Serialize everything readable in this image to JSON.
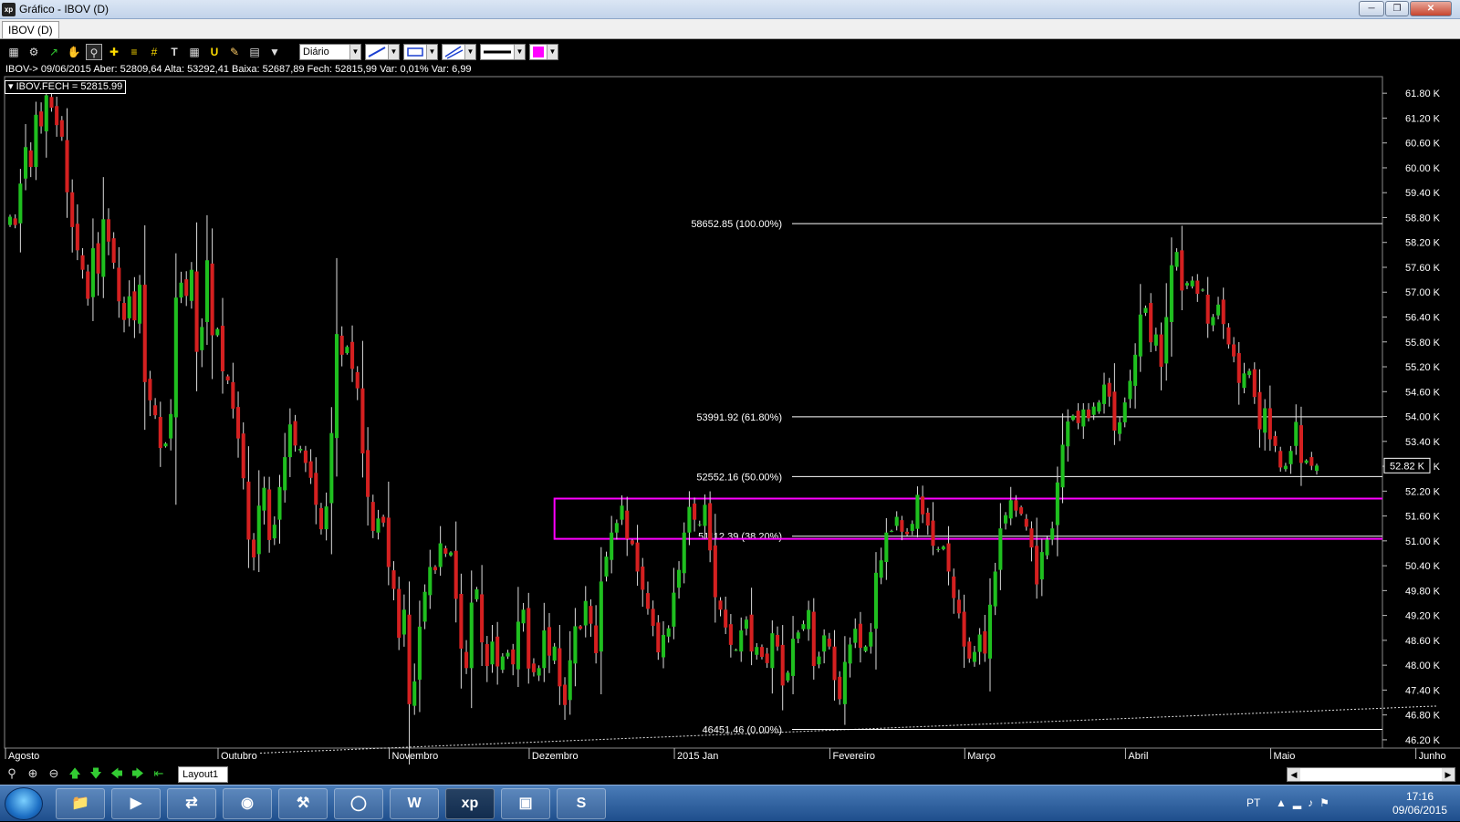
{
  "window": {
    "title": "Gráfico - IBOV (D)",
    "app_icon": "xp",
    "controls": [
      "minimize-icon",
      "restore-icon",
      "close-icon"
    ]
  },
  "tab": {
    "label": "IBOV (D)"
  },
  "toolbar": {
    "icons": [
      "chart-icon",
      "gear-icon",
      "trend-icon",
      "hand-icon",
      "zoom-select-icon",
      "crosshair-icon",
      "fibonacci-icon",
      "grid-icon",
      "text-icon",
      "calculator-icon",
      "magnet-icon",
      "brush-icon",
      "clipboard-icon",
      "filter-icon"
    ],
    "period": "Diário",
    "draw_color": "#ff00ff"
  },
  "info_line": "IBOV-> 09/06/2015 Aber: 52809,64 Alta: 53292,41 Baixa: 52687,89 Fech: 52815,99 Var: 0,01% Var: 6,99",
  "legend": "IBOV.FECH = 52815.99",
  "chart_data": {
    "type": "candlestick",
    "symbol": "IBOV",
    "ylim": [
      46000,
      62200
    ],
    "y_ticks": [
      "61.80 K",
      "61.20 K",
      "60.60 K",
      "60.00 K",
      "59.40 K",
      "58.80 K",
      "58.20 K",
      "57.60 K",
      "57.00 K",
      "56.40 K",
      "55.80 K",
      "55.20 K",
      "54.60 K",
      "54.00 K",
      "53.40 K",
      "52.80 K",
      "52.20 K",
      "51.60 K",
      "51.00 K",
      "50.40 K",
      "49.80 K",
      "49.20 K",
      "48.60 K",
      "48.00 K",
      "47.40 K",
      "46.80 K",
      "46.20 K"
    ],
    "y_tick_values": [
      61800,
      61200,
      60600,
      60000,
      59400,
      58800,
      58200,
      57600,
      57000,
      56400,
      55800,
      55200,
      54600,
      54000,
      53400,
      52800,
      52200,
      51600,
      51000,
      50400,
      49800,
      49200,
      48600,
      48000,
      47400,
      46800,
      46200
    ],
    "x_labels": [
      "Agosto",
      "Outubro",
      "Novembro",
      "Dezembro",
      "2015 Jan",
      "Fevereiro",
      "Março",
      "Abril",
      "Maio",
      "Junho"
    ],
    "x_label_index": [
      0,
      41,
      74,
      101,
      129,
      159,
      185,
      216,
      244,
      272
    ],
    "last_price_label": "52.82 K",
    "last_price": 52815.99,
    "colors": {
      "up": "#1fbf1f",
      "down": "#d42020",
      "fib": "#ffffff",
      "zone": "#ff00ff",
      "background": "#000000"
    },
    "fibonacci": [
      {
        "label": "58652.85 (100.00%)",
        "value": 58652.85
      },
      {
        "label": "53991.92 (61.80%)",
        "value": 53991.92
      },
      {
        "label": "52552.16 (50.00%)",
        "value": 52552.16
      },
      {
        "label": "51112.39 (38.20%)",
        "value": 51112.39
      },
      {
        "label": "46451.46 (0.00%)",
        "value": 46451.46
      }
    ],
    "zone": {
      "top": 52020,
      "bottom": 51050,
      "start_index": 105
    },
    "closes": [
      58820,
      58620,
      59620,
      60500,
      60020,
      61280,
      61000,
      61750,
      61450,
      61030,
      60750,
      59410,
      58570,
      58010,
      57540,
      56840,
      58060,
      57450,
      58760,
      58220,
      57710,
      56780,
      56330,
      56900,
      56320,
      57180,
      54830,
      54390,
      54030,
      53240,
      53350,
      54060,
      56870,
      57230,
      56910,
      57540,
      55560,
      56160,
      57770,
      55960,
      56110,
      55090,
      54870,
      54190,
      53470,
      52510,
      51030,
      50600,
      51850,
      52280,
      51020,
      51390,
      52300,
      53020,
      53810,
      53300,
      53220,
      52880,
      52520,
      51870,
      51280,
      51830,
      53600,
      55990,
      55490,
      55680,
      55150,
      54680,
      53110,
      52060,
      51240,
      51540,
      51440,
      50370,
      49840,
      48660,
      49340,
      47060,
      47610,
      48930,
      49770,
      50370,
      50290,
      50940,
      50690,
      50720,
      49600,
      48400,
      47930,
      49510,
      49830,
      48550,
      47980,
      48570,
      47970,
      48210,
      48300,
      48020,
      49050,
      49340,
      47920,
      47830,
      47930,
      48840,
      48230,
      48450,
      47490,
      47040,
      48120,
      48940,
      48880,
      49550,
      49000,
      48290,
      50020,
      50620,
      51200,
      51430,
      51850,
      51050,
      50920,
      50260,
      49820,
      49360,
      48950,
      48310,
      48730,
      48890,
      49750,
      50300,
      51200,
      51820,
      51510,
      51400,
      51870,
      50770,
      49640,
      49340,
      48910,
      48490,
      48370,
      48840,
      49100,
      48330,
      48440,
      48200,
      48050,
      48770,
      48450,
      47510,
      47820,
      48640,
      48790,
      48990,
      49330,
      47980,
      48210,
      48720,
      48450,
      47640,
      47180,
      48080,
      48500,
      48880,
      48420,
      48450,
      48800,
      50230,
      50530,
      51200,
      51240,
      51580,
      51220,
      51160,
      51410,
      52110,
      51640,
      51370,
      50880,
      50800,
      50860,
      50260,
      49620,
      49250,
      48450,
      48160,
      48320,
      48740,
      48280,
      49460,
      50260,
      51300,
      51620,
      51980,
      51730,
      51650,
      51340,
      50840,
      49950,
      50730,
      51030,
      51300,
      52410,
      53320,
      53880,
      54020,
      53840,
      54170,
      53960,
      54240,
      54340,
      54770,
      54480,
      53660,
      53860,
      54340,
      54860,
      55490,
      56460,
      56620,
      55790,
      55980,
      55200,
      56400,
      57650,
      57970,
      57040,
      57220,
      57280,
      56960,
      57060,
      56240,
      56400,
      56700,
      56230,
      55740,
      55450,
      54810,
      55040,
      55100,
      54470,
      53690,
      54200,
      53450,
      53290,
      52770,
      52810,
      53170,
      53870,
      52880,
      52940,
      52810,
      52816
    ]
  },
  "nav": {
    "icons": [
      "zoom-icon",
      "zoom-in-icon",
      "zoom-out-icon",
      "arrow-up-icon",
      "arrow-down-icon",
      "arrow-left-icon",
      "arrow-right-icon",
      "arrow-left-end-icon"
    ],
    "layout_tab": "Layout1"
  },
  "taskbar": {
    "apps": [
      "folder-icon",
      "media-player-icon",
      "network-icon",
      "hp-icon",
      "tools-icon",
      "chrome-icon",
      "word-icon",
      "xp-icon",
      "photos-icon",
      "skype-icon"
    ],
    "app_labels": {
      "word": "W",
      "xp": "xp"
    },
    "tray_lang": "PT",
    "time": "17:16",
    "date": "09/06/2015"
  }
}
